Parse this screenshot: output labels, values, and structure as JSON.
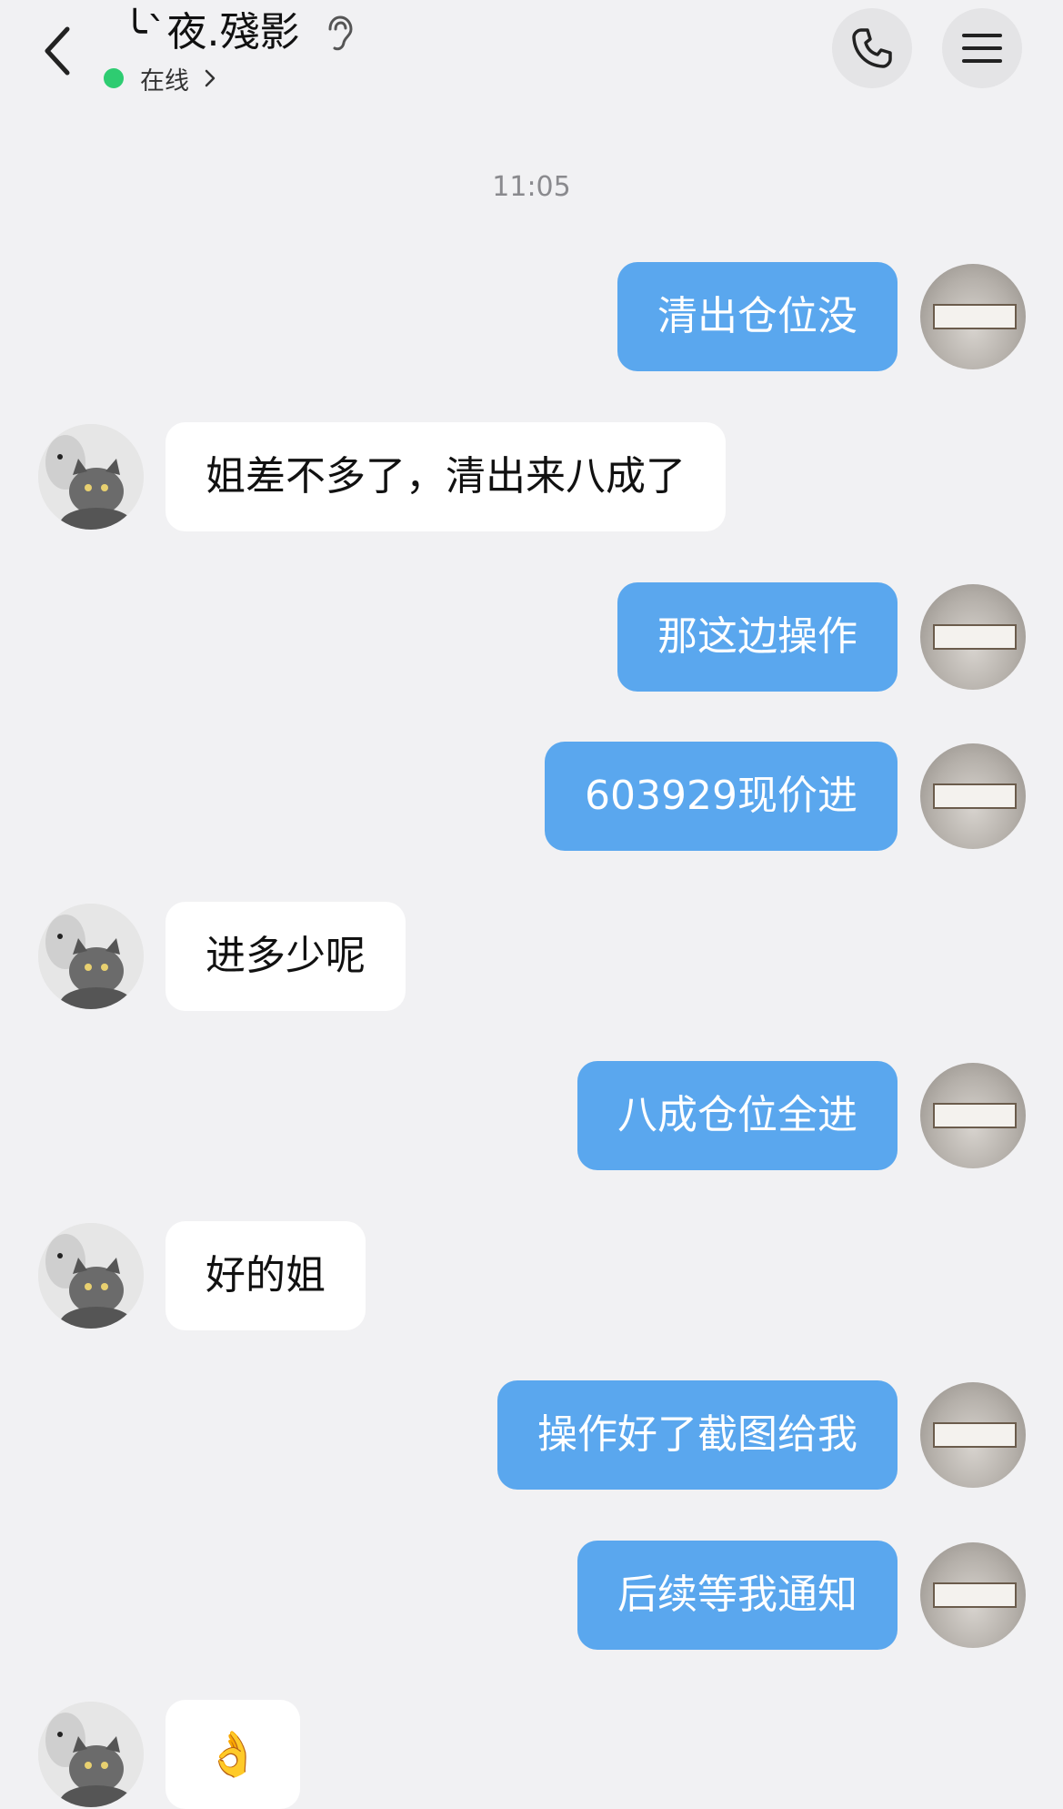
{
  "header": {
    "contact_name": "╰`夜.殘影",
    "status_text": "在线",
    "icons": {
      "back": "chevron-left-icon",
      "ear": "ear-icon",
      "phone": "phone-icon",
      "menu": "menu-icon"
    },
    "status_color": "#2ecc71"
  },
  "chat": {
    "timestamp": "11:05",
    "messages": [
      {
        "side": "out",
        "text": "清出仓位没"
      },
      {
        "side": "in",
        "text": "姐差不多了，清出来八成了"
      },
      {
        "side": "out",
        "text": "那这边操作"
      },
      {
        "side": "out",
        "text": "603929现价进"
      },
      {
        "side": "in",
        "text": "进多少呢"
      },
      {
        "side": "out",
        "text": "八成仓位全进"
      },
      {
        "side": "in",
        "text": "好的姐"
      },
      {
        "side": "out",
        "text": "操作好了截图给我"
      },
      {
        "side": "out",
        "text": "后续等我通知"
      },
      {
        "side": "in",
        "text": "👌"
      }
    ]
  },
  "colors": {
    "outgoing_bubble": "#5aa7ee",
    "incoming_bubble": "#ffffff",
    "background": "#f1f1f3"
  }
}
